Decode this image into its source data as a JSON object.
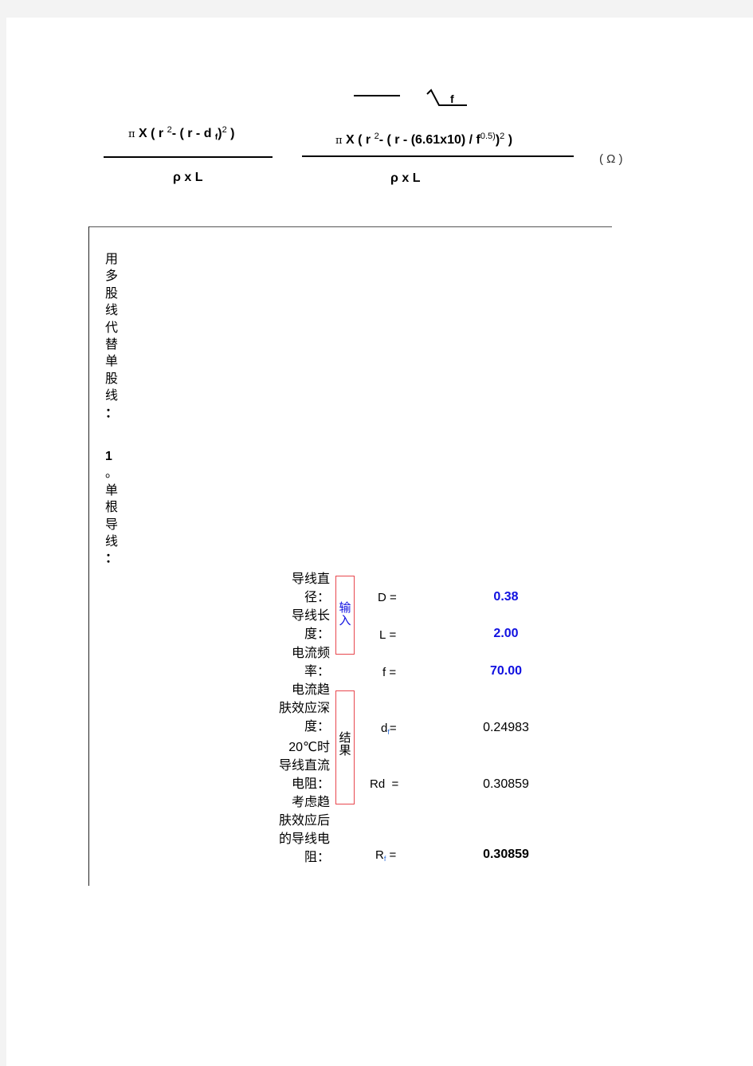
{
  "header_formula": {
    "sqrt_label": "f",
    "formula_dc": {
      "numerator": {
        "pi": "π",
        "x": "X",
        "open": "( r",
        "exp": "2",
        "mid": "- ( r - d",
        "sub": "f",
        "close": ")",
        "exp2": "2",
        "end": ")"
      },
      "denominator": "ρ x  L"
    },
    "formula_ac": {
      "numerator": {
        "pi": "π",
        "x": "X",
        "open": "( r",
        "exp": "2",
        "mid": "- ( r - (6.61x10)  /  f",
        "exp_f": "0.5)",
        "exp2": "2",
        "end": ")"
      },
      "denominator": "ρ x  L"
    },
    "unit": "( Ω )"
  },
  "section": {
    "title_chars": [
      "用",
      "多",
      "股",
      "线",
      "代",
      "替",
      "单",
      "股",
      "线",
      "："
    ],
    "subtitle_chars": [
      "1",
      "。",
      "单",
      "根",
      "导",
      "线",
      "："
    ]
  },
  "input_group": {
    "tag": "输入",
    "rows": [
      {
        "label_lines": [
          "导线直",
          "径："
        ],
        "symbol": "D",
        "sub": "",
        "eq": "=",
        "value": "0.38"
      },
      {
        "label_lines": [
          "导线长",
          "度："
        ],
        "symbol": "L",
        "sub": "",
        "eq": "=",
        "value": "2.00"
      },
      {
        "label_lines": [
          "电流频",
          "率："
        ],
        "symbol": "f",
        "sub": "",
        "eq": "=",
        "value": "70.00"
      }
    ]
  },
  "result_group": {
    "tag": "结果",
    "rows": [
      {
        "label_lines": [
          "电流趋",
          "肤效应深",
          "度："
        ],
        "symbol": "d",
        "sub": "f",
        "eq": "=",
        "value": "0.24983"
      },
      {
        "label_lines": [
          "20℃时",
          "导线直流",
          "电阻："
        ],
        "symbol": "Rd",
        "sub": "",
        "eq": "=",
        "value": "0.30859"
      },
      {
        "label_lines": [
          "考虑趋",
          "肤效应后",
          "的导线电",
          "阻："
        ],
        "symbol": "R",
        "sub": "f",
        "eq": "=",
        "value": "0.30859"
      }
    ]
  }
}
